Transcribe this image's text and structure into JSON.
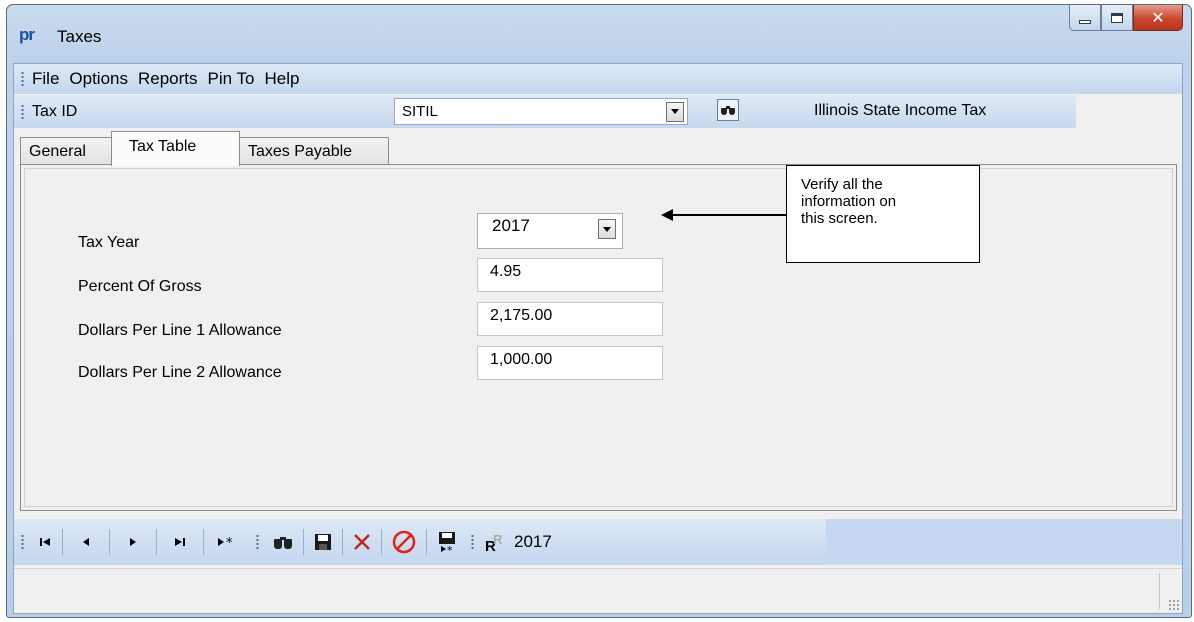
{
  "window": {
    "title": "Taxes",
    "app_icon_text": "pr"
  },
  "menu": {
    "items": [
      "File",
      "Options",
      "Reports",
      "Pin To",
      "Help"
    ]
  },
  "taxbar": {
    "label": "Tax ID",
    "value": "SITIL",
    "description": "Illinois State Income Tax"
  },
  "tabs": [
    {
      "label": "General",
      "active": false
    },
    {
      "label": "Tax Table",
      "active": true
    },
    {
      "label": "Taxes Payable",
      "active": false
    }
  ],
  "form": {
    "tax_year_label": "Tax Year",
    "tax_year_value": "2017",
    "percent_label": "Percent Of Gross",
    "percent_value": "4.95",
    "line1_label": "Dollars Per Line 1 Allowance",
    "line1_value": "2,175.00",
    "line2_label": "Dollars Per Line 2 Allowance",
    "line2_value": "1,000.00"
  },
  "callout": {
    "line1": "Verify all the",
    "line2": "information on",
    "line3": "this screen."
  },
  "navbar": {
    "year": "2017"
  },
  "icons": {
    "first": "first-record-icon",
    "prev": "previous-record-icon",
    "next": "next-record-icon",
    "last": "last-record-icon",
    "new": "new-record-icon",
    "find": "binoculars-icon",
    "save": "save-icon",
    "delete": "delete-icon",
    "cancel": "cancel-icon",
    "save_new": "save-and-new-icon",
    "report": "report-icon"
  },
  "colors": {
    "delete": "#c0281c",
    "cancel": "#e0231a",
    "title_bar": "#bcd2ea",
    "close_button": "#c9462f"
  }
}
